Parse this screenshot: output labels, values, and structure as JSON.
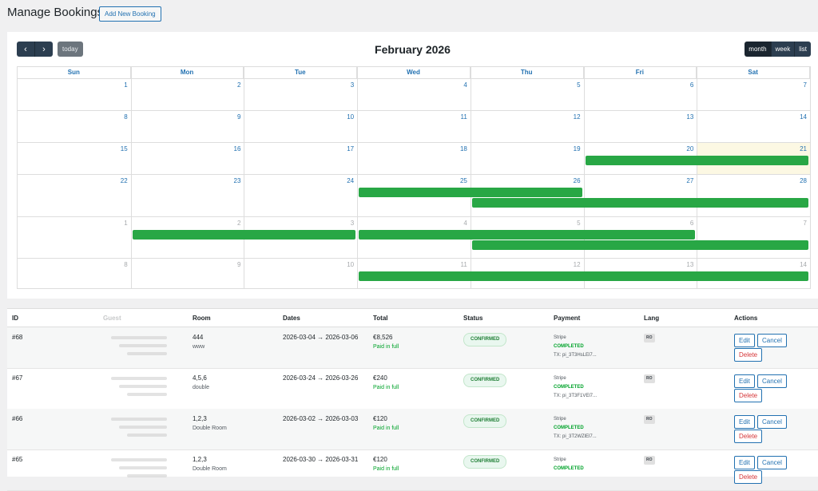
{
  "header": {
    "title": "Manage Bookings",
    "add_label": "Add New Booking"
  },
  "calendar": {
    "title": "February 2026",
    "today_label": "today",
    "views": [
      "month",
      "week",
      "list"
    ],
    "days": [
      "Sun",
      "Mon",
      "Tue",
      "Wed",
      "Thu",
      "Fri",
      "Sat"
    ],
    "weeks": [
      [
        "1",
        "2",
        "3",
        "4",
        "5",
        "6",
        "7"
      ],
      [
        "8",
        "9",
        "10",
        "11",
        "12",
        "13",
        "14"
      ],
      [
        "15",
        "16",
        "17",
        "18",
        "19",
        "20",
        "21"
      ],
      [
        "22",
        "23",
        "24",
        "25",
        "26",
        "27",
        "28"
      ],
      [
        "1",
        "2",
        "3",
        "4",
        "5",
        "6",
        "7"
      ],
      [
        "8",
        "9",
        "10",
        "11",
        "12",
        "13",
        "14"
      ]
    ]
  },
  "table": {
    "headers": [
      "ID",
      "Guest",
      "Room",
      "Dates",
      "Total",
      "Status",
      "Payment",
      "Lang",
      "Actions"
    ],
    "rows": [
      {
        "id": "#68",
        "room": "444",
        "room_type": "www",
        "dates": "2026-03-04 → 2026-03-06",
        "total": "€8,526",
        "paid": "Paid in full",
        "status": "CONFIRMED",
        "pay_method": "Stripe",
        "pay_status": "COMPLETED",
        "tx": "TX: pi_3T3HsLEl7...",
        "lang": "RO"
      },
      {
        "id": "#67",
        "room": "4,5,6",
        "room_type": "double",
        "dates": "2026-03-24 → 2026-03-26",
        "total": "€240",
        "paid": "Paid in full",
        "status": "CONFIRMED",
        "pay_method": "Stripe",
        "pay_status": "COMPLETED",
        "tx": "TX: pi_3T3F1VEl7...",
        "lang": "RO"
      },
      {
        "id": "#66",
        "room": "1,2,3",
        "room_type": "Double Room",
        "dates": "2026-03-02 → 2026-03-03",
        "total": "€120",
        "paid": "Paid in full",
        "status": "CONFIRMED",
        "pay_method": "Stripe",
        "pay_status": "COMPLETED",
        "tx": "TX: pi_3T2WZlEl7...",
        "lang": "RO"
      },
      {
        "id": "#65",
        "room": "1,2,3",
        "room_type": "Double Room",
        "dates": "2026-03-30 → 2026-03-31",
        "total": "€120",
        "paid": "Paid in full",
        "status": "CONFIRMED",
        "pay_method": "Stripe",
        "pay_status": "COMPLETED",
        "tx": "",
        "lang": "RO"
      }
    ],
    "actions": {
      "edit": "Edit",
      "cancel": "Cancel",
      "delete": "Delete"
    }
  }
}
